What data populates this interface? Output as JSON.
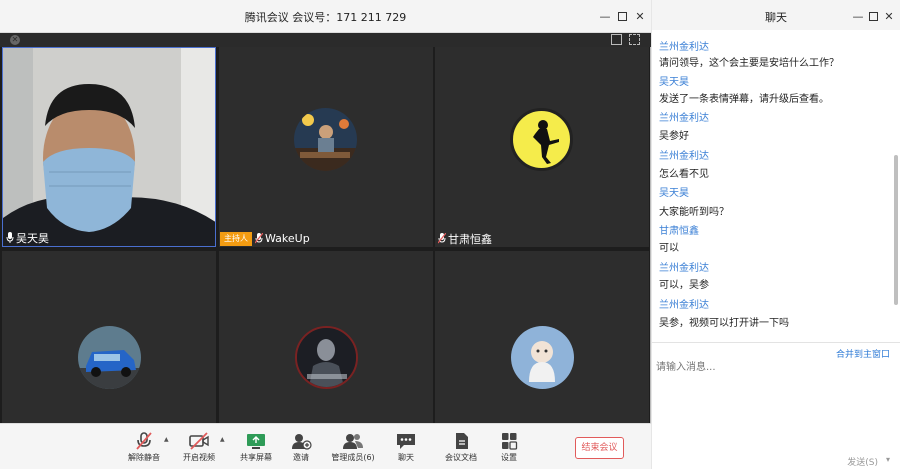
{
  "meeting": {
    "title": "腾讯会议  会议号：171 211 729",
    "participants": [
      {
        "name": "吴天昊",
        "host": false,
        "avatar": "face-camera-feed"
      },
      {
        "name": "WakeUp",
        "host": true,
        "host_label": "主持人",
        "avatar": "dj-stage-photo"
      },
      {
        "name": "甘肃恒鑫",
        "host": false,
        "avatar": "dancer-silhouette-icon"
      },
      {
        "name": "",
        "host": false,
        "avatar": "blue-suv-photo"
      },
      {
        "name": "",
        "host": false,
        "avatar": "game-character-avatar"
      },
      {
        "name": "",
        "host": false,
        "avatar": "cartoon-baby-avatar"
      }
    ],
    "toolbar": {
      "unmute": "解除静音",
      "video": "开启视频",
      "share": "共享屏幕",
      "invite": "邀请",
      "members": "管理成员(6)",
      "chat": "聊天",
      "docs": "会议文档",
      "settings": "设置",
      "end": "结束会议"
    }
  },
  "chat": {
    "title": "聊天",
    "messages": [
      {
        "sender": "兰州金利达",
        "text": "请问领导，这个会主要是安培什么工作？"
      },
      {
        "sender": "吴天昊",
        "text": "发送了一条表情弹幕，请升级后查看。"
      },
      {
        "sender": "兰州金利达",
        "text": "吴参好"
      },
      {
        "sender": "兰州金利达",
        "text": "怎么看不见"
      },
      {
        "sender": "吴天昊",
        "text": "大家能听到吗？"
      },
      {
        "sender": "甘肃恒鑫",
        "text": "可以"
      },
      {
        "sender": "兰州金利达",
        "text": "可以，吴参"
      },
      {
        "sender": "兰州金利达",
        "text": "吴参，视频可以打开讲一下吗"
      }
    ],
    "merge_link": "合并到主窗口",
    "input_placeholder": "请输入消息...",
    "send_label": "发送(S)"
  },
  "colors": {
    "accent": "#3a7fd5",
    "host_badge": "#f39c12",
    "end_button": "#e15b5b",
    "tile_bg": "#2d2d2d"
  }
}
